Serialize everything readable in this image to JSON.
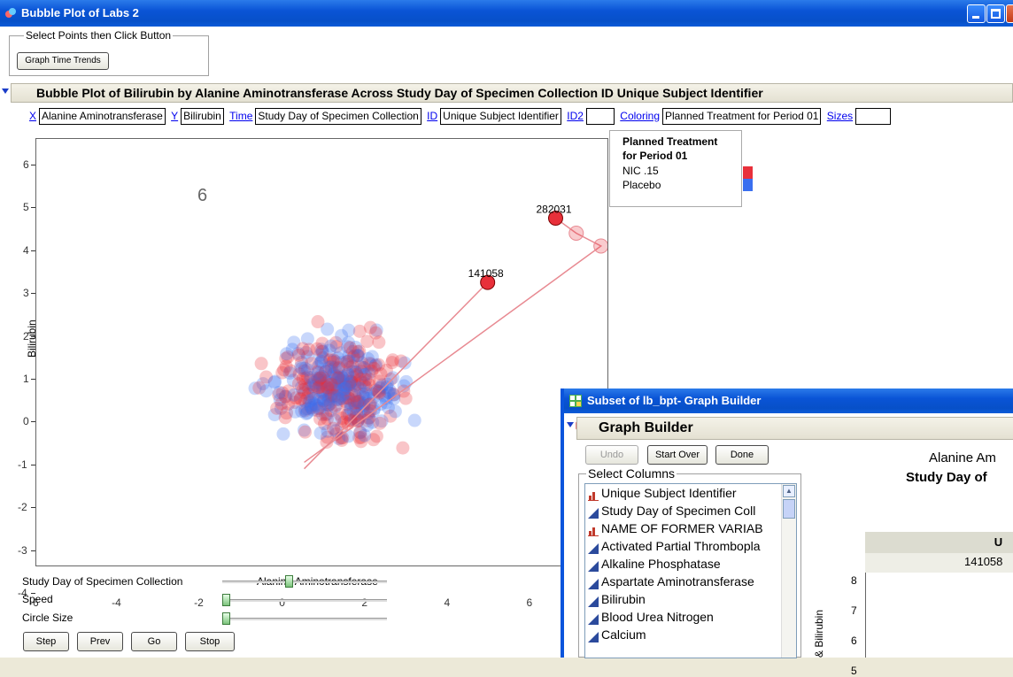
{
  "window": {
    "title": "Bubble Plot of Labs 2"
  },
  "selector": {
    "group_label": "Select Points then Click Button",
    "button_label": "Graph Time Trends"
  },
  "report": {
    "title": "Bubble Plot of Bilirubin by Alanine Aminotransferase Across Study Day of Specimen Collection ID Unique Subject Identifier"
  },
  "roles": {
    "x_link": "X",
    "x_value": "Alanine Aminotransferase",
    "y_link": "Y",
    "y_value": "Bilirubin",
    "time_link": "Time",
    "time_value": "Study Day of Specimen Collection",
    "id_link": "ID",
    "id_value": "Unique Subject Identifier",
    "id2_link": "ID2",
    "id2_value": "",
    "coloring_link": "Coloring",
    "coloring_value": "Planned Treatment for Period 01",
    "sizes_link": "Sizes",
    "sizes_value": ""
  },
  "chart_data": {
    "type": "scatter",
    "xlabel": "Alanine Aminotransferase",
    "ylabel": "Bilirubin",
    "xlim": [
      -6,
      7.9
    ],
    "ylim": [
      -4,
      6
    ],
    "x_ticks": [
      "-6",
      "-4",
      "-2",
      "0",
      "2",
      "4",
      "6"
    ],
    "y_ticks": [
      "6",
      "5",
      "4",
      "3",
      "2",
      "1",
      "0",
      "-1",
      "-2",
      "-3",
      "-4"
    ],
    "frame_label": "6",
    "colors": {
      "nic": "#e8303a",
      "placebo": "#3a6ff0"
    },
    "labeled_points": [
      {
        "label": "141058",
        "x": 4.95,
        "y": 2.65
      },
      {
        "label": "282031",
        "x": 6.6,
        "y": 4.15
      }
    ],
    "trails": [
      [
        [
          0.5,
          -1.7
        ],
        [
          4.95,
          2.65
        ]
      ],
      [
        [
          0.5,
          -1.55
        ],
        [
          7.7,
          3.5
        ],
        [
          7.1,
          3.8
        ],
        [
          6.6,
          4.15
        ]
      ]
    ]
  },
  "legend": {
    "title": "Planned Treatment for Period 01",
    "items": [
      {
        "label": "NIC .15",
        "color": "#e8303a"
      },
      {
        "label": "Placebo",
        "color": "#3a6ff0"
      }
    ]
  },
  "controls": {
    "sliders": [
      {
        "label": "Study Day of Specimen Collection",
        "value": 0.38
      },
      {
        "label": "Speed",
        "value": 0.0
      },
      {
        "label": "Circle Size",
        "value": 0.0
      }
    ],
    "buttons": [
      "Step",
      "Prev",
      "Go",
      "Stop"
    ]
  },
  "graph_builder": {
    "title": "Subset of lb_bpt- Graph Builder",
    "outline": "Graph Builder",
    "undo": "Undo",
    "start_over": "Start Over",
    "done": "Done",
    "select_columns": "Select Columns",
    "columns": [
      {
        "label": "Unique Subject Identifier",
        "icon": "nominal-bar-icon"
      },
      {
        "label": "Study Day of Specimen Coll",
        "icon": "continuous-triangle-icon"
      },
      {
        "label": "NAME OF FORMER VARIAB",
        "icon": "nominal-bar-icon"
      },
      {
        "label": "Activated Partial Thrombopla",
        "icon": "continuous-triangle-icon"
      },
      {
        "label": "Alkaline Phosphatase",
        "icon": "continuous-triangle-icon"
      },
      {
        "label": "Aspartate Aminotransferase",
        "icon": "continuous-triangle-icon"
      },
      {
        "label": "Bilirubin",
        "icon": "continuous-triangle-icon"
      },
      {
        "label": "Blood Urea Nitrogen",
        "icon": "continuous-triangle-icon"
      },
      {
        "label": "Calcium",
        "icon": "continuous-triangle-icon"
      }
    ],
    "graph_title_1": "Alanine Am",
    "graph_title_2": "Study Day of",
    "header_letter": "U",
    "group_value": "141058",
    "y_axis_label": "& Bilirubin",
    "y_ticks": [
      "8",
      "7",
      "6",
      "5"
    ]
  }
}
